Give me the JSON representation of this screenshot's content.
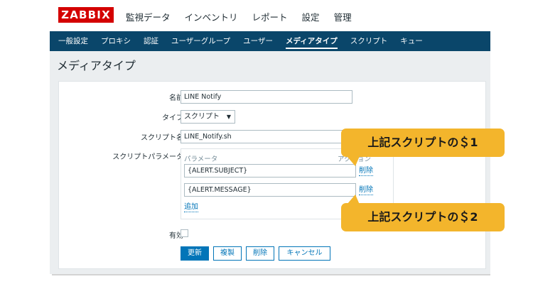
{
  "logo": "ZABBIX",
  "top_menu": [
    "監視データ",
    "インベントリ",
    "レポート",
    "設定",
    "管理"
  ],
  "sub_nav": [
    "一般設定",
    "プロキシ",
    "認証",
    "ユーザーグループ",
    "ユーザー",
    "メディアタイプ",
    "スクリプト",
    "キュー"
  ],
  "sub_nav_active": "メディアタイプ",
  "page_title": "メディアタイプ",
  "form": {
    "name_label": "名前",
    "name_value": "LINE Notify",
    "type_label": "タイプ",
    "type_value": "スクリプト",
    "script_name_label": "スクリプト名",
    "script_name_value": "LINE_Notify.sh",
    "script_params_label": "スクリプトパラメータ",
    "params_header": "パラメータ",
    "params_action_header": "アクション",
    "params": [
      {
        "value": "{ALERT.SUBJECT}",
        "remove_label": "削除"
      },
      {
        "value": "{ALERT.MESSAGE}",
        "remove_label": "削除"
      }
    ],
    "add_label": "追加",
    "enabled_label": "有効",
    "enabled": false
  },
  "buttons": {
    "update": "更新",
    "clone": "複製",
    "delete": "削除",
    "cancel": "キャンセル"
  },
  "callouts": [
    "上記スクリプトの＄1",
    "上記スクリプトの＄2"
  ],
  "colors": {
    "logo_bg": "#d40000",
    "subnav_bg": "#0a466a",
    "link": "#0275b8",
    "primary_button": "#0275b8",
    "callout_bg": "#f3b52c"
  }
}
